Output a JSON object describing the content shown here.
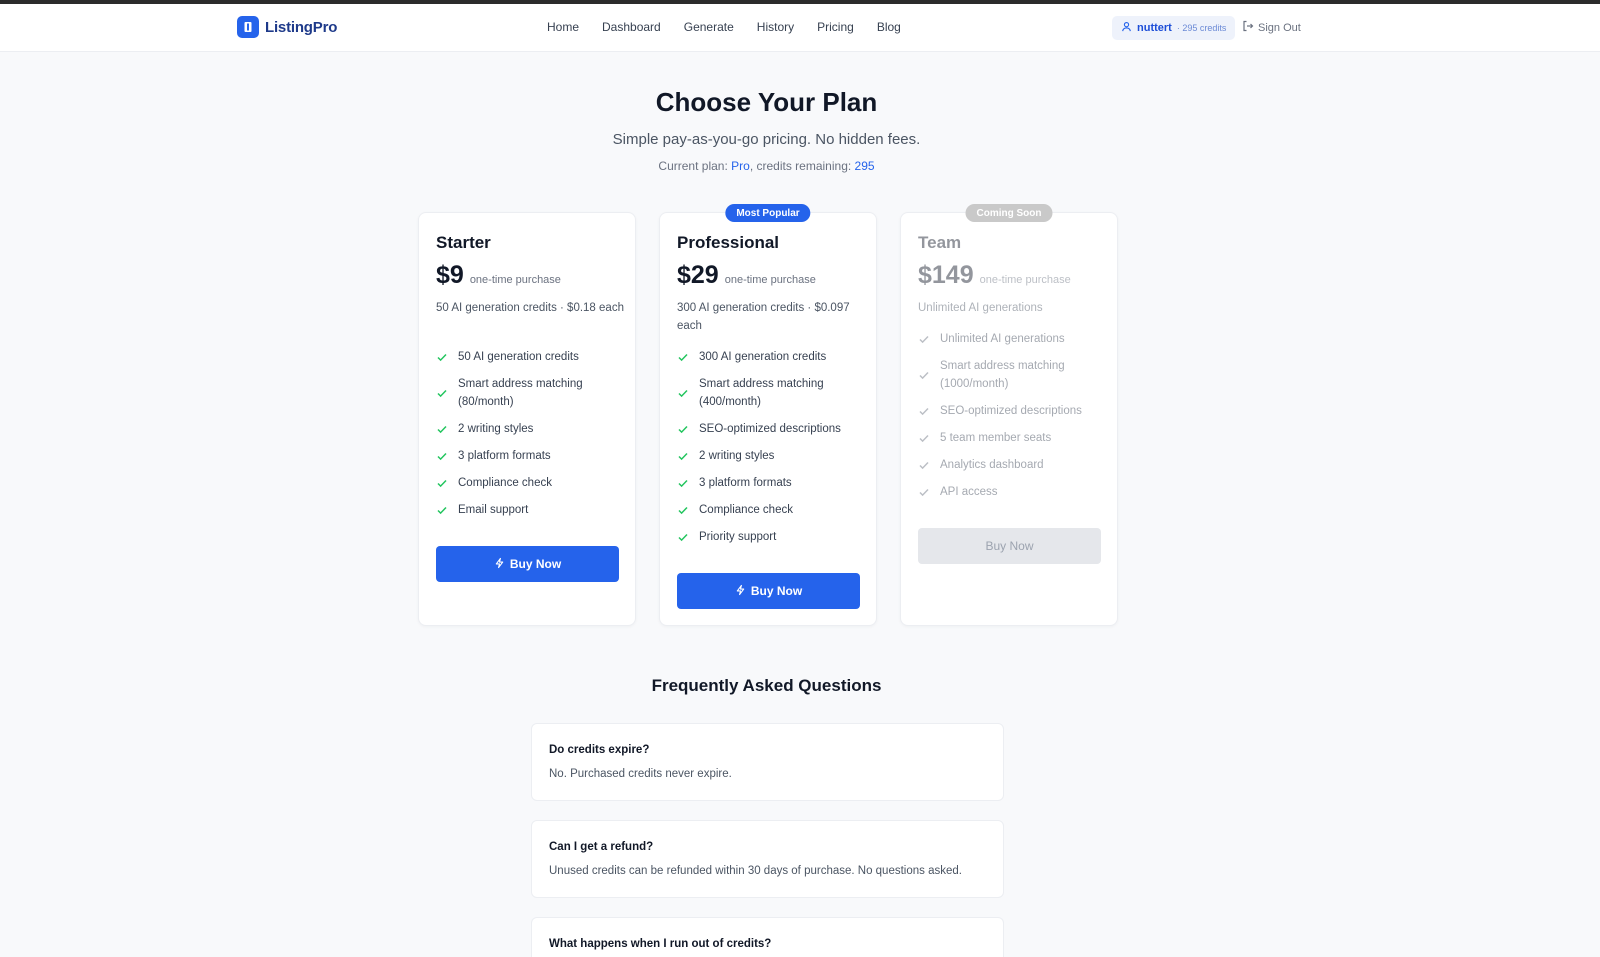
{
  "brand": {
    "name": "ListingPro",
    "color": "#2563eb"
  },
  "nav": {
    "links": [
      "Home",
      "Dashboard",
      "Generate",
      "History",
      "Pricing",
      "Blog"
    ]
  },
  "user": {
    "name": "nuttert",
    "credits_label": "· 295 credits",
    "sign_out": "Sign Out"
  },
  "hero": {
    "title": "Choose Your Plan",
    "subtitle": "Simple pay-as-you-go pricing. No hidden fees.",
    "current_plan_prefix": "Current plan:",
    "current_plan": "Pro",
    "credits_prefix": ", credits remaining:",
    "credits_remaining": "295"
  },
  "plans": [
    {
      "name": "Starter",
      "price": "$9",
      "price_note": "one-time purchase",
      "desc": "50 AI generation credits · $0.18 each",
      "features": [
        "50 AI generation credits",
        "Smart address matching (80/month)",
        "2 writing styles",
        "3 platform formats",
        "Compliance check",
        "Email support"
      ],
      "button": "Buy Now"
    },
    {
      "name": "Professional",
      "badge": "Most Popular",
      "price": "$29",
      "price_note": "one-time purchase",
      "desc": "300 AI generation credits · $0.097 each",
      "features": [
        "300 AI generation credits",
        "Smart address matching (400/month)",
        "SEO-optimized descriptions",
        "2 writing styles",
        "3 platform formats",
        "Compliance check",
        "Priority support"
      ],
      "button": "Buy Now"
    },
    {
      "name": "Team",
      "badge": "Coming Soon",
      "price": "$149",
      "price_note": "one-time purchase",
      "desc": "Unlimited AI generations",
      "features": [
        "Unlimited AI generations",
        "Smart address matching (1000/month)",
        "SEO-optimized descriptions",
        "5 team member seats",
        "Analytics dashboard",
        "API access"
      ],
      "button": "Buy Now"
    }
  ],
  "faq": {
    "title": "Frequently Asked Questions",
    "items": [
      {
        "q": "Do credits expire?",
        "a": "No. Purchased credits never expire."
      },
      {
        "q": "Can I get a refund?",
        "a": "Unused credits can be refunded within 30 days of purchase. No questions asked."
      },
      {
        "q": "What happens when I run out of credits?",
        "a": ""
      }
    ]
  },
  "colors": {
    "accent": "#2563eb",
    "check": "#22c55e",
    "background": "#f8f9fb"
  }
}
